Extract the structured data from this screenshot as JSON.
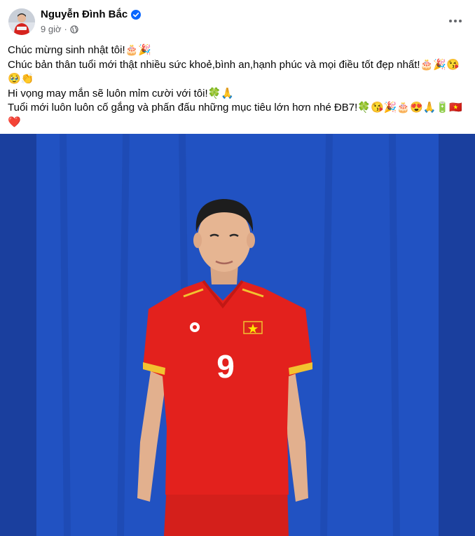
{
  "post": {
    "author": "Nguyễn Đình Bắc",
    "time": "9 giờ",
    "separator": "·",
    "lines": [
      "Chúc mừng sinh nhật tôi!🎂🎉",
      "Chúc bản thân tuổi mới thật nhiều sức khoẻ,bình an,hạnh phúc và mọi điều tốt đẹp nhất!🎂🎉😘",
      "🥹👏",
      "Hi vọng may mắn sẽ luôn mỉm cười với tôi!🍀🙏",
      "Tuổi mới luôn luôn cố gắng và phấn đấu những mục tiêu lớn hơn nhé ĐB7!🍀😘🎉🎂😍🙏🔋🇻🇳",
      "❤️"
    ],
    "jersey_number": "9",
    "colors": {
      "backdrop": "#1f4bb4",
      "jersey": "#e3211d",
      "verified": "#0866ff",
      "meta": "#65676b"
    },
    "icons": [
      "verified-badge-icon",
      "globe-icon",
      "more-options-icon"
    ]
  }
}
